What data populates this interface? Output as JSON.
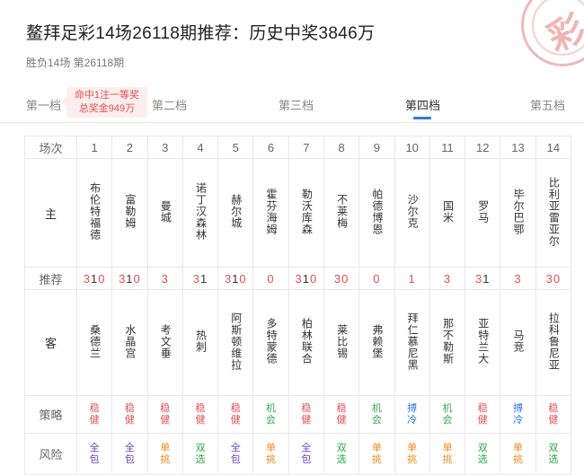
{
  "header": {
    "title": "鳌拜足彩14场26118期推荐：历史中奖3846万",
    "subtitle": "胜负14场 第26118期"
  },
  "stamp": {
    "text": "彩"
  },
  "tabs": [
    {
      "label": "第一档"
    },
    {
      "label": "第二档"
    },
    {
      "label": "第三档"
    },
    {
      "label": "第四档"
    },
    {
      "label": "第五档"
    }
  ],
  "promo": {
    "line1": "命中1注一等奖",
    "line2": "总奖金949万"
  },
  "table": {
    "labels": {
      "match": "场次",
      "home": "主",
      "rec": "推荐",
      "away": "客",
      "strategy": "策略",
      "risk": "风险"
    },
    "matches": [
      {
        "no": "1",
        "home": "布伦特福德",
        "away": "桑德兰",
        "rec": "310",
        "strategy": "稳健",
        "risk": "全包"
      },
      {
        "no": "2",
        "home": "富勒姆",
        "away": "水晶宫",
        "rec": "310",
        "strategy": "稳健",
        "risk": "全包"
      },
      {
        "no": "3",
        "home": "曼城",
        "away": "考文垂",
        "rec": "3",
        "strategy": "稳健",
        "risk": "单挑"
      },
      {
        "no": "4",
        "home": "诺丁汉森林",
        "away": "热刺",
        "rec": "31",
        "strategy": "稳健",
        "risk": "双选"
      },
      {
        "no": "5",
        "home": "赫尔城",
        "away": "阿斯顿维拉",
        "rec": "310",
        "strategy": "稳健",
        "risk": "全包"
      },
      {
        "no": "6",
        "home": "霍芬海姆",
        "away": "多特蒙德",
        "rec": "0",
        "strategy": "机会",
        "risk": "单挑"
      },
      {
        "no": "7",
        "home": "勒沃库森",
        "away": "柏林联合",
        "rec": "310",
        "strategy": "稳健",
        "risk": "全包"
      },
      {
        "no": "8",
        "home": "不莱梅",
        "away": "莱比锡",
        "rec": "30",
        "strategy": "稳健",
        "risk": "双选"
      },
      {
        "no": "9",
        "home": "帕德博恩",
        "away": "弗赖堡",
        "rec": "0",
        "strategy": "机会",
        "risk": "单挑"
      },
      {
        "no": "10",
        "home": "沙尔克",
        "away": "拜仁慕尼黑",
        "rec": "1",
        "strategy": "搏冷",
        "risk": "单挑"
      },
      {
        "no": "11",
        "home": "国米",
        "away": "那不勒斯",
        "rec": "3",
        "strategy": "机会",
        "risk": "单挑"
      },
      {
        "no": "12",
        "home": "罗马",
        "away": "亚特兰大",
        "rec": "31",
        "strategy": "稳健",
        "risk": "双选"
      },
      {
        "no": "13",
        "home": "毕尔巴鄂",
        "away": "马竞",
        "rec": "3",
        "strategy": "搏冷",
        "risk": "单挑"
      },
      {
        "no": "14",
        "home": "比利亚雷亚尔",
        "away": "拉科鲁尼亚",
        "rec": "30",
        "strategy": "稳健",
        "risk": "双选"
      }
    ]
  },
  "colors": {
    "accent": "#2d7be0",
    "red": "#e0504f",
    "green": "#2fa84f",
    "blue": "#2d7be0",
    "orange": "#f08a24",
    "purple": "#6a3fd1"
  }
}
